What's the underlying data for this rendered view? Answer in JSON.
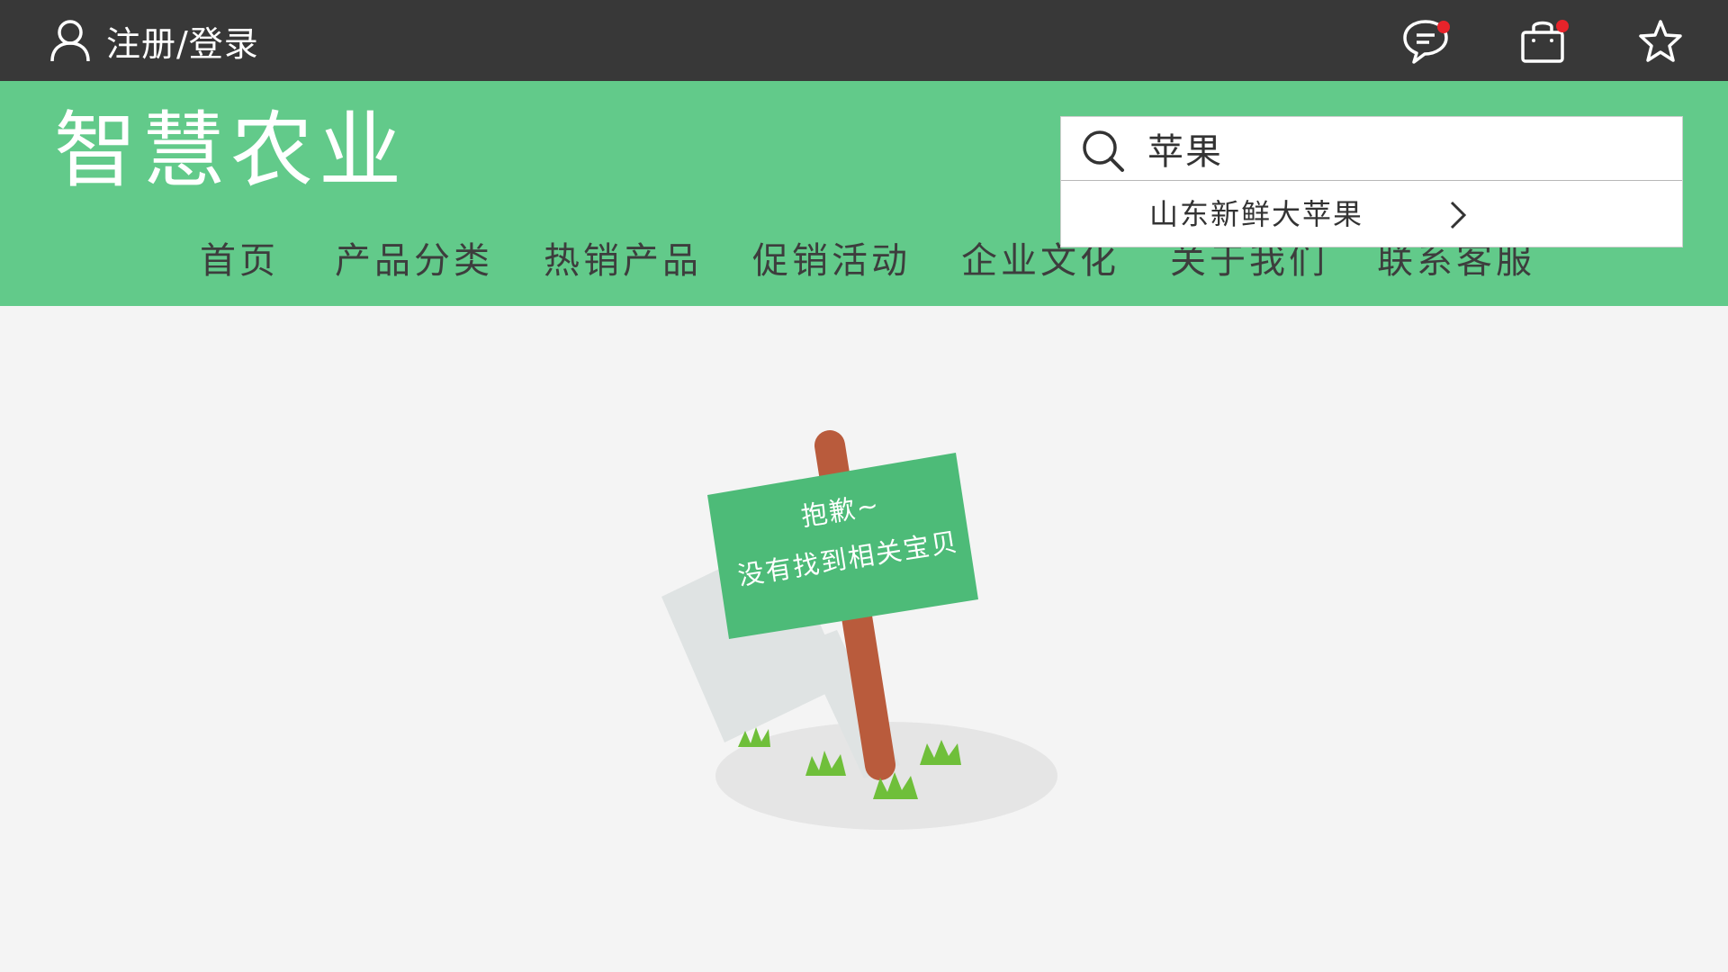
{
  "topbar": {
    "login_label": "注册/登录",
    "icons": [
      "user-icon",
      "message-icon",
      "cart-icon",
      "star-icon"
    ],
    "badge_color": "#e8232a"
  },
  "header": {
    "logo": "智慧农业",
    "background": "#62ca8a"
  },
  "nav": {
    "items": [
      {
        "label": "首页"
      },
      {
        "label": "产品分类"
      },
      {
        "label": "热销产品"
      },
      {
        "label": "促销活动"
      },
      {
        "label": "企业文化"
      },
      {
        "label": "关于我们"
      },
      {
        "label": "联系客服"
      }
    ]
  },
  "search": {
    "value": "苹果",
    "suggestion": "山东新鲜大苹果"
  },
  "empty_state": {
    "line1": "抱歉~",
    "line2": "没有找到相关宝贝"
  }
}
